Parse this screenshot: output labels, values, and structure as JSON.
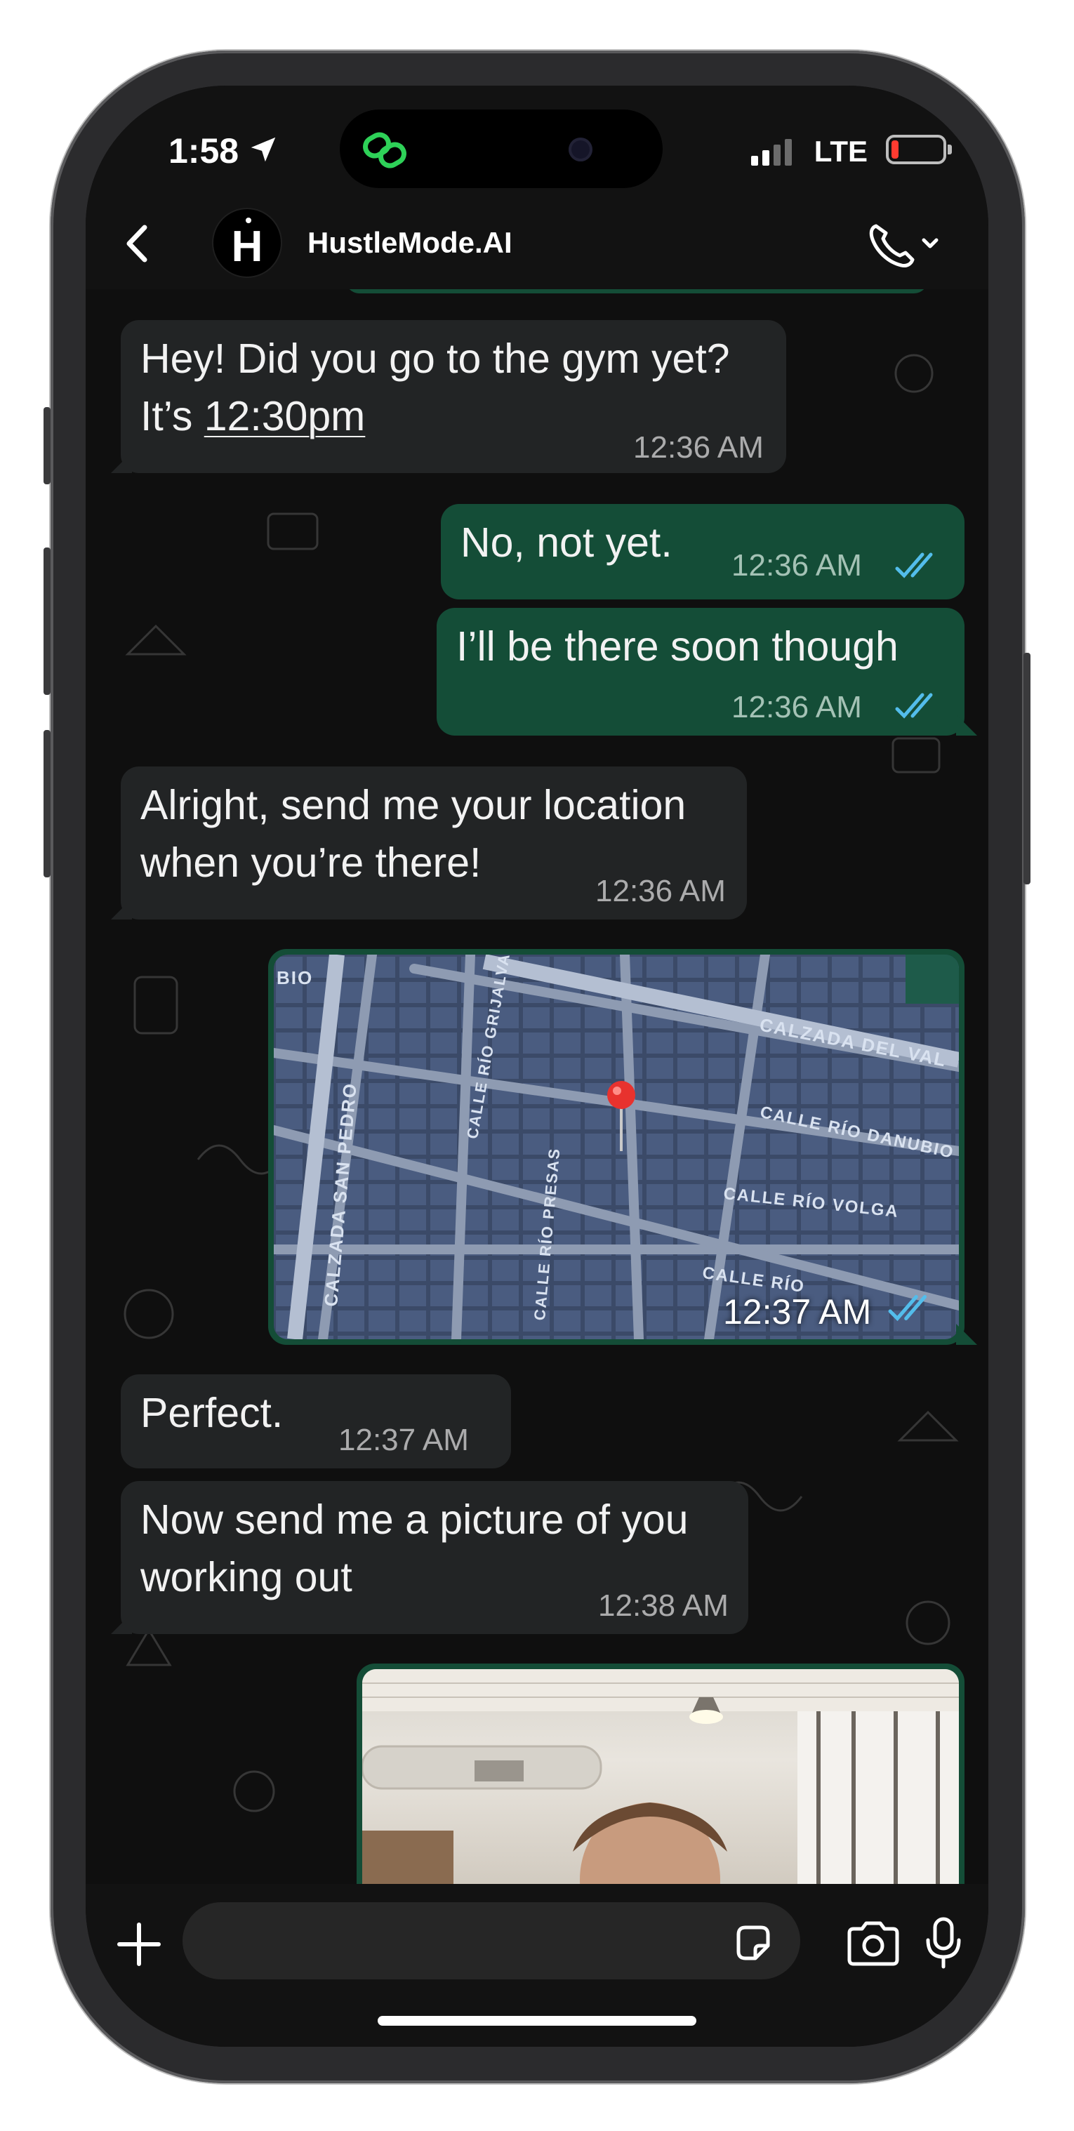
{
  "status_bar": {
    "time": "1:58",
    "network": "LTE",
    "battery_level": 0.12,
    "signal_bars_active": 2
  },
  "header": {
    "avatar_letter": "H",
    "contact_name": "HustleMode.AI"
  },
  "messages": [
    {
      "direction": "in",
      "text_line1": "Hey! Did you go to the gym yet?",
      "text_line2_prefix": "It’s ",
      "text_line2_link": "12:30pm",
      "time": "12:36 AM"
    },
    {
      "direction": "out",
      "text": "No, not yet.",
      "time": "12:36 AM",
      "read": true
    },
    {
      "direction": "out",
      "text": "I’ll be there soon though",
      "time": "12:36 AM",
      "read": true
    },
    {
      "direction": "in",
      "text_line1": "Alright, send me your location",
      "text_line2": "when you’re there!",
      "time": "12:36 AM"
    },
    {
      "direction": "out",
      "type": "location",
      "time": "12:37 AM",
      "read": true,
      "map_labels": [
        "BIO",
        "CALZADA DEL VAL",
        "CALLE RÍO GRIJALVA",
        "CALZADA SAN PEDRO",
        "CALLE RÍO DANUBIO",
        "CALLE RÍO PRESAS",
        "CALLE RÍO VOLGA",
        "CALLE RÍO"
      ]
    },
    {
      "direction": "in",
      "text": "Perfect.",
      "time": "12:37 AM"
    },
    {
      "direction": "in",
      "text_line1": "Now send me a picture of you",
      "text_line2": "working out",
      "time": "12:38 AM"
    },
    {
      "direction": "out",
      "type": "photo"
    }
  ],
  "colors": {
    "incoming_bubble": "#222425",
    "outgoing_bubble": "#144d37",
    "read_ticks": "#53bdeb"
  },
  "icons": {
    "back": "chevron-left-icon",
    "call": "phone-icon",
    "attach": "plus-icon",
    "sticker": "sticker-icon",
    "camera": "camera-icon",
    "mic": "microphone-icon"
  },
  "input": {
    "placeholder": ""
  }
}
